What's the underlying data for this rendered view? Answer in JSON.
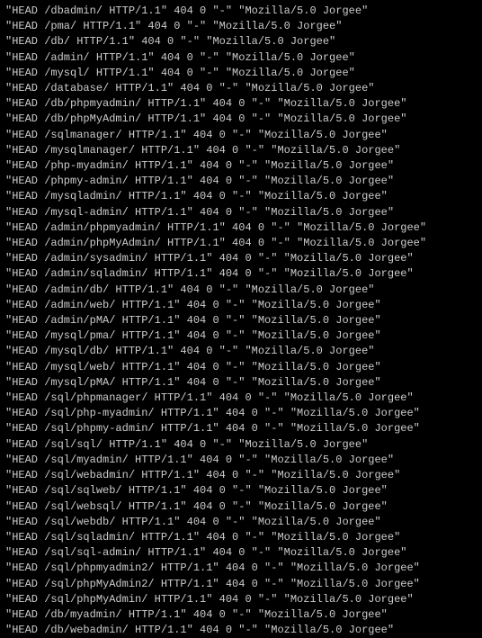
{
  "log": {
    "lines": [
      "\"HEAD /dbadmin/ HTTP/1.1\" 404 0 \"-\" \"Mozilla/5.0 Jorgee\"",
      "\"HEAD /pma/ HTTP/1.1\" 404 0 \"-\" \"Mozilla/5.0 Jorgee\"",
      "\"HEAD /db/ HTTP/1.1\" 404 0 \"-\" \"Mozilla/5.0 Jorgee\"",
      "\"HEAD /admin/ HTTP/1.1\" 404 0 \"-\" \"Mozilla/5.0 Jorgee\"",
      "\"HEAD /mysql/ HTTP/1.1\" 404 0 \"-\" \"Mozilla/5.0 Jorgee\"",
      "\"HEAD /database/ HTTP/1.1\" 404 0 \"-\" \"Mozilla/5.0 Jorgee\"",
      "\"HEAD /db/phpmyadmin/ HTTP/1.1\" 404 0 \"-\" \"Mozilla/5.0 Jorgee\"",
      "\"HEAD /db/phpMyAdmin/ HTTP/1.1\" 404 0 \"-\" \"Mozilla/5.0 Jorgee\"",
      "\"HEAD /sqlmanager/ HTTP/1.1\" 404 0 \"-\" \"Mozilla/5.0 Jorgee\"",
      "\"HEAD /mysqlmanager/ HTTP/1.1\" 404 0 \"-\" \"Mozilla/5.0 Jorgee\"",
      "\"HEAD /php-myadmin/ HTTP/1.1\" 404 0 \"-\" \"Mozilla/5.0 Jorgee\"",
      "\"HEAD /phpmy-admin/ HTTP/1.1\" 404 0 \"-\" \"Mozilla/5.0 Jorgee\"",
      "\"HEAD /mysqladmin/ HTTP/1.1\" 404 0 \"-\" \"Mozilla/5.0 Jorgee\"",
      "\"HEAD /mysql-admin/ HTTP/1.1\" 404 0 \"-\" \"Mozilla/5.0 Jorgee\"",
      "\"HEAD /admin/phpmyadmin/ HTTP/1.1\" 404 0 \"-\" \"Mozilla/5.0 Jorgee\"",
      "\"HEAD /admin/phpMyAdmin/ HTTP/1.1\" 404 0 \"-\" \"Mozilla/5.0 Jorgee\"",
      "\"HEAD /admin/sysadmin/ HTTP/1.1\" 404 0 \"-\" \"Mozilla/5.0 Jorgee\"",
      "\"HEAD /admin/sqladmin/ HTTP/1.1\" 404 0 \"-\" \"Mozilla/5.0 Jorgee\"",
      "\"HEAD /admin/db/ HTTP/1.1\" 404 0 \"-\" \"Mozilla/5.0 Jorgee\"",
      "\"HEAD /admin/web/ HTTP/1.1\" 404 0 \"-\" \"Mozilla/5.0 Jorgee\"",
      "\"HEAD /admin/pMA/ HTTP/1.1\" 404 0 \"-\" \"Mozilla/5.0 Jorgee\"",
      "\"HEAD /mysql/pma/ HTTP/1.1\" 404 0 \"-\" \"Mozilla/5.0 Jorgee\"",
      "\"HEAD /mysql/db/ HTTP/1.1\" 404 0 \"-\" \"Mozilla/5.0 Jorgee\"",
      "\"HEAD /mysql/web/ HTTP/1.1\" 404 0 \"-\" \"Mozilla/5.0 Jorgee\"",
      "\"HEAD /mysql/pMA/ HTTP/1.1\" 404 0 \"-\" \"Mozilla/5.0 Jorgee\"",
      "\"HEAD /sql/phpmanager/ HTTP/1.1\" 404 0 \"-\" \"Mozilla/5.0 Jorgee\"",
      "\"HEAD /sql/php-myadmin/ HTTP/1.1\" 404 0 \"-\" \"Mozilla/5.0 Jorgee\"",
      "\"HEAD /sql/phpmy-admin/ HTTP/1.1\" 404 0 \"-\" \"Mozilla/5.0 Jorgee\"",
      "\"HEAD /sql/sql/ HTTP/1.1\" 404 0 \"-\" \"Mozilla/5.0 Jorgee\"",
      "\"HEAD /sql/myadmin/ HTTP/1.1\" 404 0 \"-\" \"Mozilla/5.0 Jorgee\"",
      "\"HEAD /sql/webadmin/ HTTP/1.1\" 404 0 \"-\" \"Mozilla/5.0 Jorgee\"",
      "\"HEAD /sql/sqlweb/ HTTP/1.1\" 404 0 \"-\" \"Mozilla/5.0 Jorgee\"",
      "\"HEAD /sql/websql/ HTTP/1.1\" 404 0 \"-\" \"Mozilla/5.0 Jorgee\"",
      "\"HEAD /sql/webdb/ HTTP/1.1\" 404 0 \"-\" \"Mozilla/5.0 Jorgee\"",
      "\"HEAD /sql/sqladmin/ HTTP/1.1\" 404 0 \"-\" \"Mozilla/5.0 Jorgee\"",
      "\"HEAD /sql/sql-admin/ HTTP/1.1\" 404 0 \"-\" \"Mozilla/5.0 Jorgee\"",
      "\"HEAD /sql/phpmyadmin2/ HTTP/1.1\" 404 0 \"-\" \"Mozilla/5.0 Jorgee\"",
      "\"HEAD /sql/phpMyAdmin2/ HTTP/1.1\" 404 0 \"-\" \"Mozilla/5.0 Jorgee\"",
      "\"HEAD /sql/phpMyAdmin/ HTTP/1.1\" 404 0 \"-\" \"Mozilla/5.0 Jorgee\"",
      "\"HEAD /db/myadmin/ HTTP/1.1\" 404 0 \"-\" \"Mozilla/5.0 Jorgee\"",
      "\"HEAD /db/webadmin/ HTTP/1.1\" 404 0 \"-\" \"Mozilla/5.0 Jorgee\""
    ]
  }
}
